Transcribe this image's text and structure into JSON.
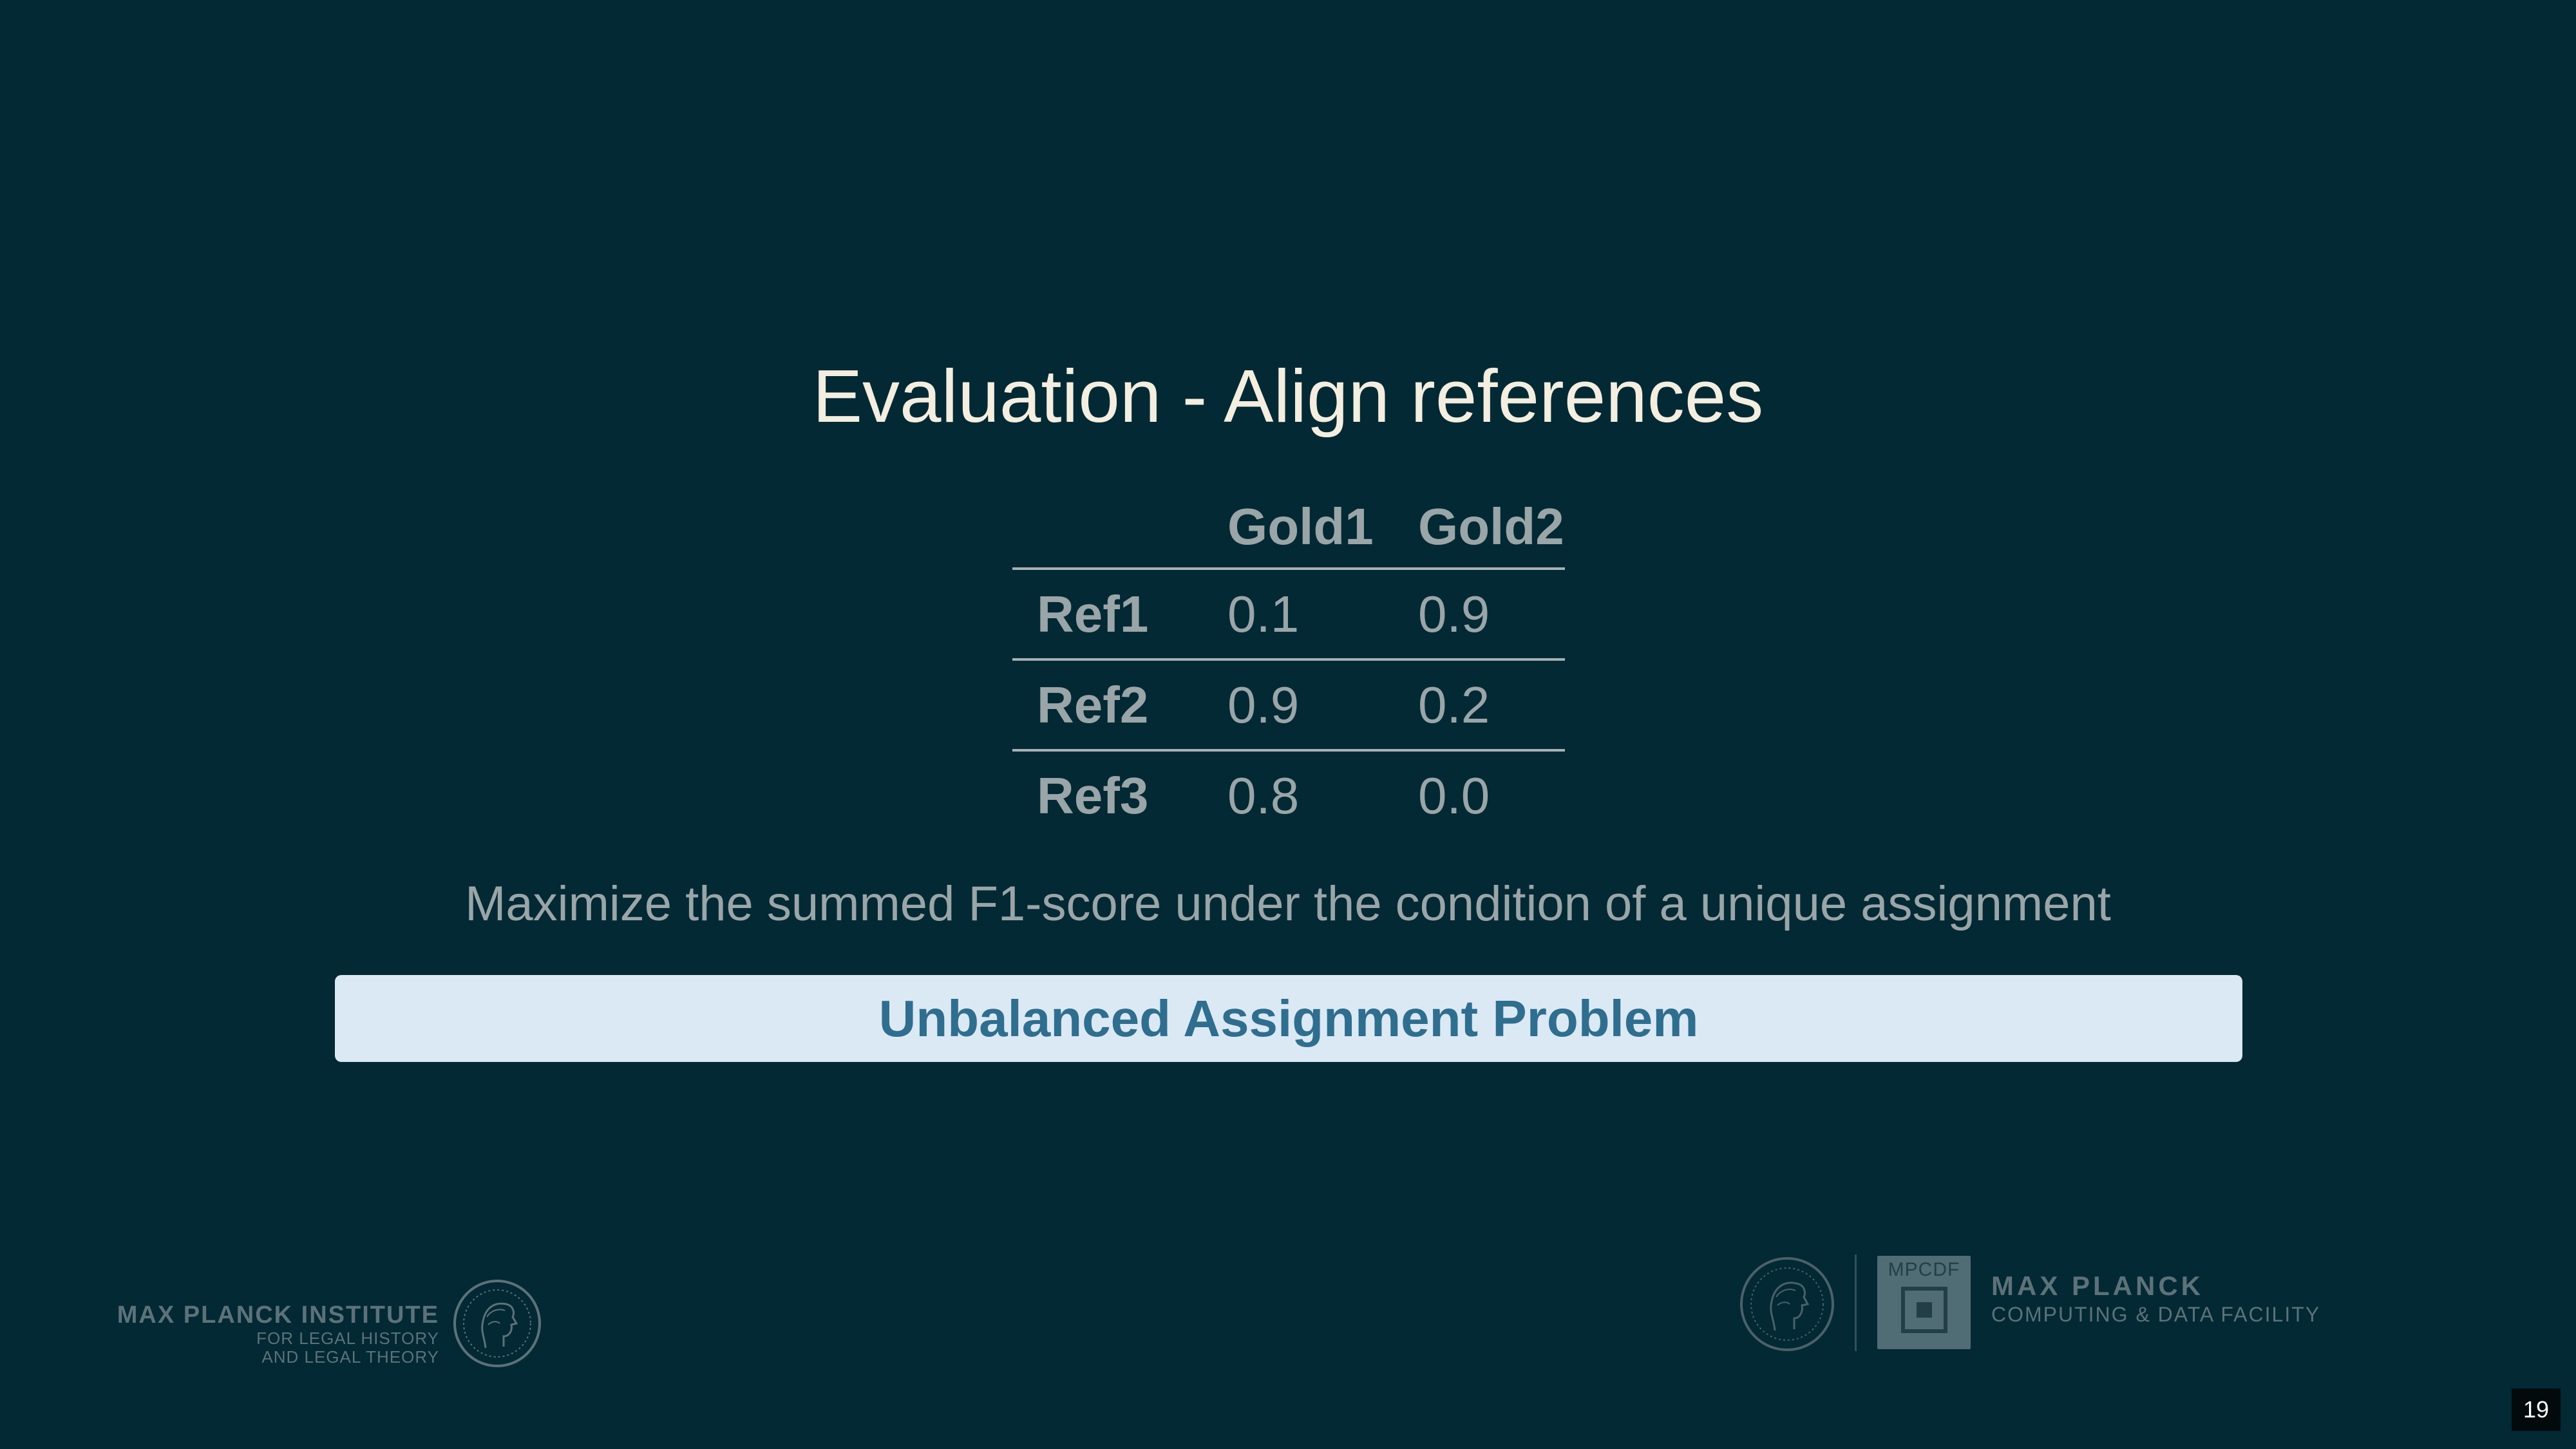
{
  "slide": {
    "title": "Evaluation - Align references",
    "table": {
      "headers": [
        "",
        "Gold1",
        "Gold2"
      ],
      "rows": [
        {
          "label": "Ref1",
          "values": [
            "0.1",
            "0.9"
          ]
        },
        {
          "label": "Ref2",
          "values": [
            "0.9",
            "0.2"
          ]
        },
        {
          "label": "Ref3",
          "values": [
            "0.8",
            "0.0"
          ]
        }
      ]
    },
    "statement": "Maximize the summed F1-score under the condition of a unique assignment",
    "callout": "Unbalanced Assignment Problem",
    "page_number": "19"
  },
  "footer": {
    "left_logo": {
      "line1": "MAX PLANCK INSTITUTE",
      "line2": "FOR LEGAL HISTORY",
      "line3": "AND LEGAL THEORY",
      "icon": "minerva-seal-icon"
    },
    "right_logo": {
      "box_label": "MPCDF",
      "line1": "MAX PLANCK",
      "line2": "COMPUTING & DATA FACILITY",
      "icon": "minerva-seal-icon"
    }
  },
  "colors": {
    "background": "#022934",
    "title": "#f3eedf",
    "text": "#9aa5a8",
    "callout_bg": "#dbe9f4",
    "callout_text": "#2f6e8f",
    "logo": "#5c7278"
  }
}
